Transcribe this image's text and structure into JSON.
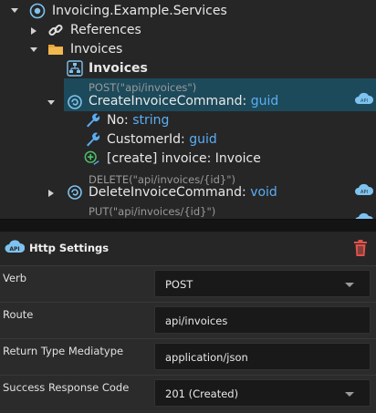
{
  "tree": {
    "root_label": "Invoicing.Example.Services",
    "references_label": "References",
    "invoices_folder_label": "Invoices",
    "invoices_service_label": "Invoices",
    "create_command": {
      "annotation": "POST(\"api/invoices\")",
      "name": "CreateInvoiceCommand:",
      "type": "guid"
    },
    "fields": [
      {
        "name": "No:",
        "type": "string"
      },
      {
        "name": "CustomerId:",
        "type": "guid"
      }
    ],
    "create_assoc_label": "[create] invoice: Invoice",
    "delete_command": {
      "annotation": "DELETE(\"api/invoices/{id}\")",
      "name": "DeleteInvoiceCommand:",
      "type": "void"
    },
    "put_annotation": "PUT(\"api/invoices/{id}\")"
  },
  "properties": {
    "title": "Http Settings",
    "rows": [
      {
        "label": "Verb",
        "value": "POST",
        "dropdown": true
      },
      {
        "label": "Route",
        "value": "api/invoices",
        "dropdown": false
      },
      {
        "label": "Return Type Mediatype",
        "value": "application/json",
        "dropdown": false
      },
      {
        "label": "Success Response Code",
        "value": "201 (Created)",
        "dropdown": true
      }
    ]
  },
  "colors": {
    "selection": "#1d4a5a",
    "type_text": "#5aaef5",
    "folder": "#e8a33a",
    "delete_red": "#e0524a",
    "cloud_blue": "#7ec3f0"
  }
}
